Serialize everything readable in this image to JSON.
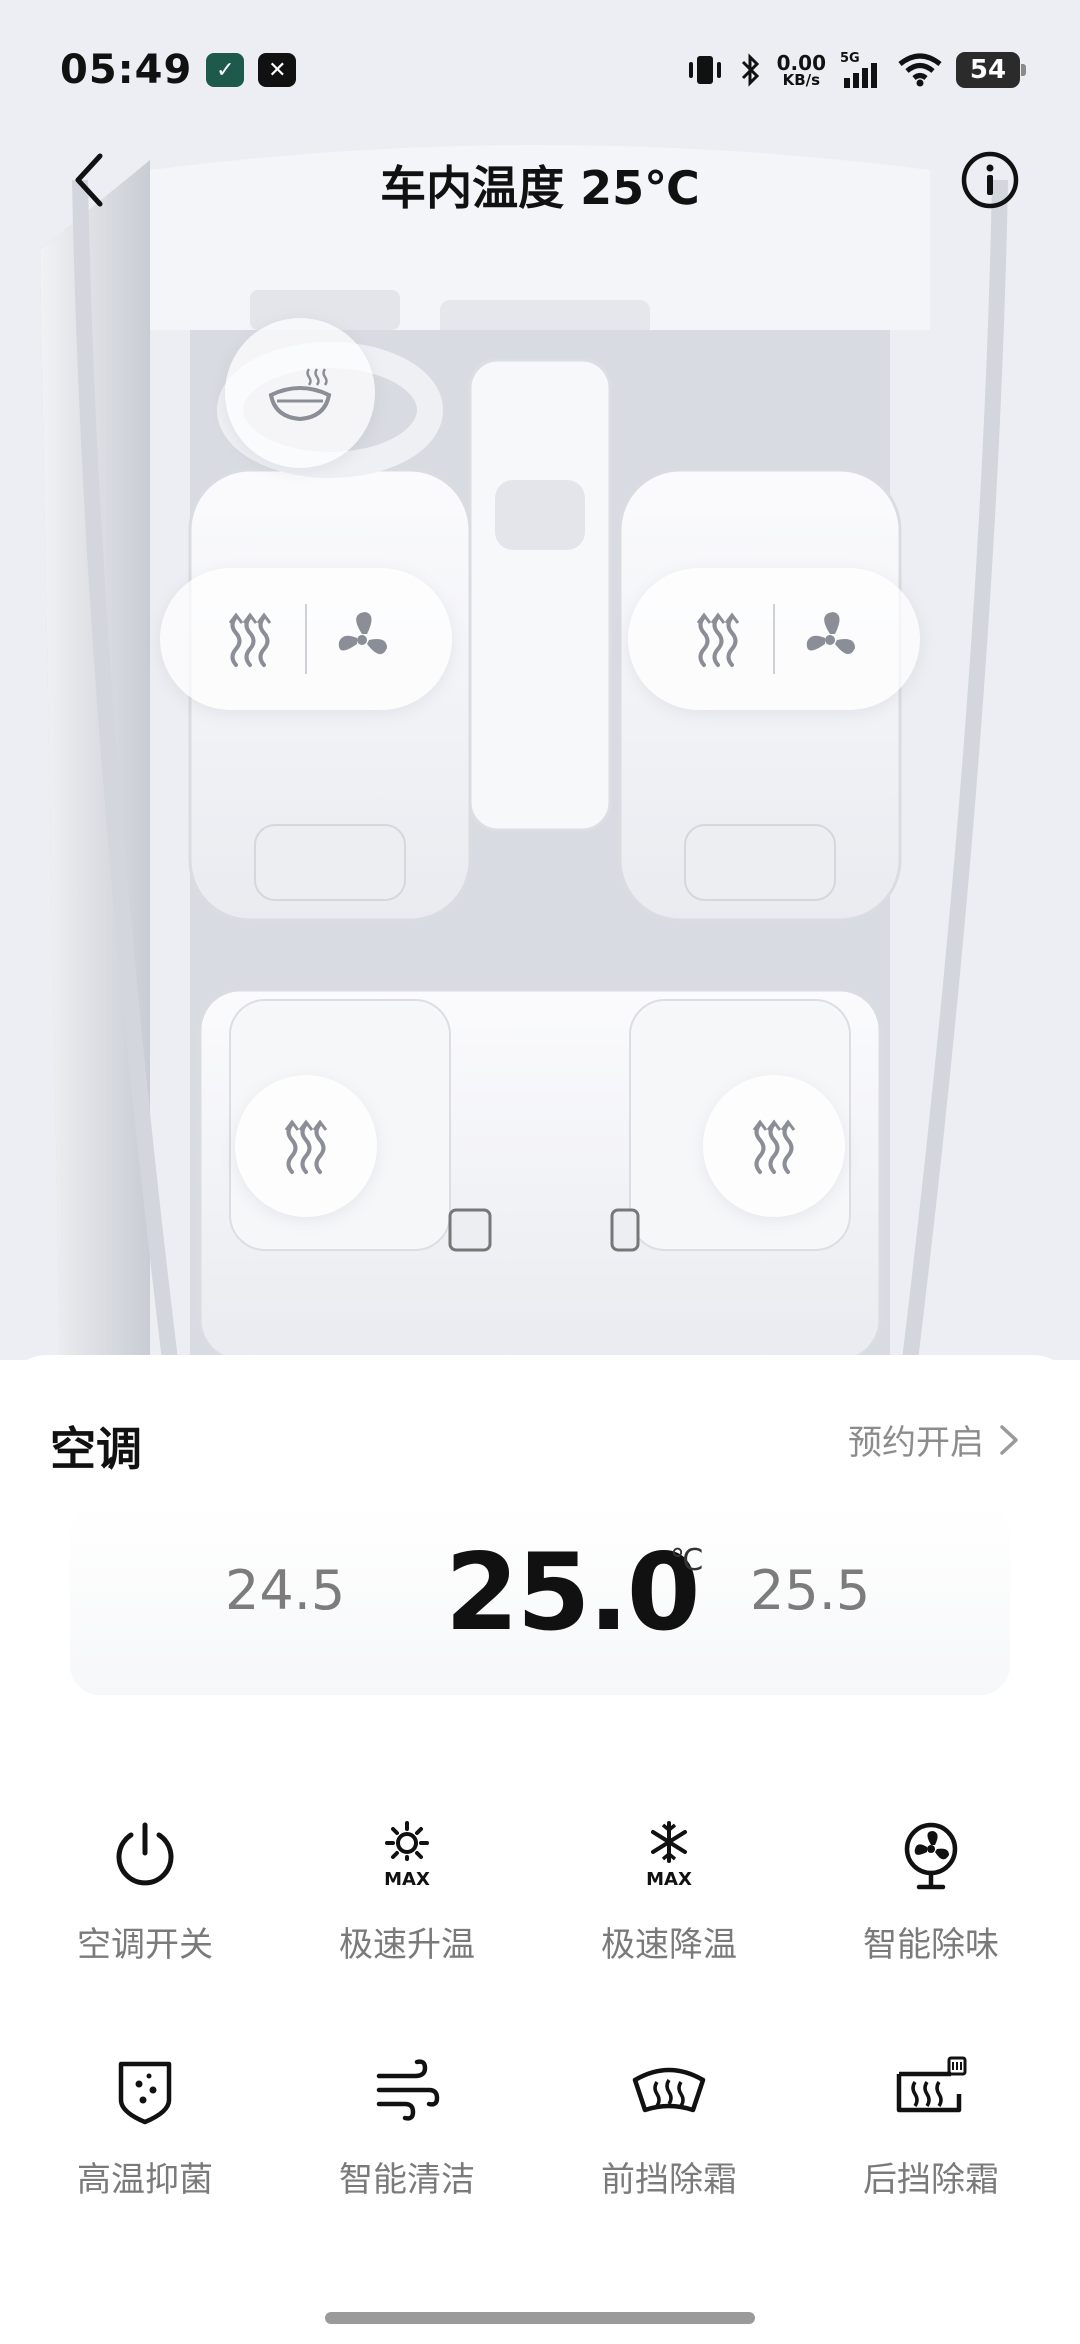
{
  "status_bar": {
    "time": "05:49",
    "net_speed_value": "0.00",
    "net_speed_unit": "KB/s",
    "network": "5G",
    "battery": "54"
  },
  "header": {
    "title": "车内温度 25℃"
  },
  "seat_controls": {
    "steering_heat_icon": "steering-wheel-heat-icon",
    "front_left": [
      "seat-heat-icon",
      "seat-ventilation-icon"
    ],
    "front_right": [
      "seat-heat-icon",
      "seat-ventilation-icon"
    ],
    "rear_left": "seat-heat-icon",
    "rear_right": "seat-heat-icon"
  },
  "ac_panel": {
    "title": "空调",
    "schedule_label": "预约开启",
    "temp_prev": "24.5",
    "temp_current": "25.0",
    "temp_unit": "℃",
    "temp_next": "25.5",
    "controls": [
      {
        "label": "空调开关",
        "icon": "power-icon"
      },
      {
        "label": "极速升温",
        "icon": "max-heat-icon"
      },
      {
        "label": "极速降温",
        "icon": "max-cool-icon"
      },
      {
        "label": "智能除味",
        "icon": "fan-deodorize-icon"
      },
      {
        "label": "高温抑菌",
        "icon": "shield-sterilize-icon"
      },
      {
        "label": "智能清洁",
        "icon": "wind-clean-icon"
      },
      {
        "label": "前挡除霜",
        "icon": "front-defrost-icon"
      },
      {
        "label": "后挡除霜",
        "icon": "rear-defrost-icon"
      }
    ]
  },
  "colors": {
    "accent_text": "#111111",
    "muted_text": "#7a7a7a",
    "car_bg": "#e6e8ee"
  }
}
